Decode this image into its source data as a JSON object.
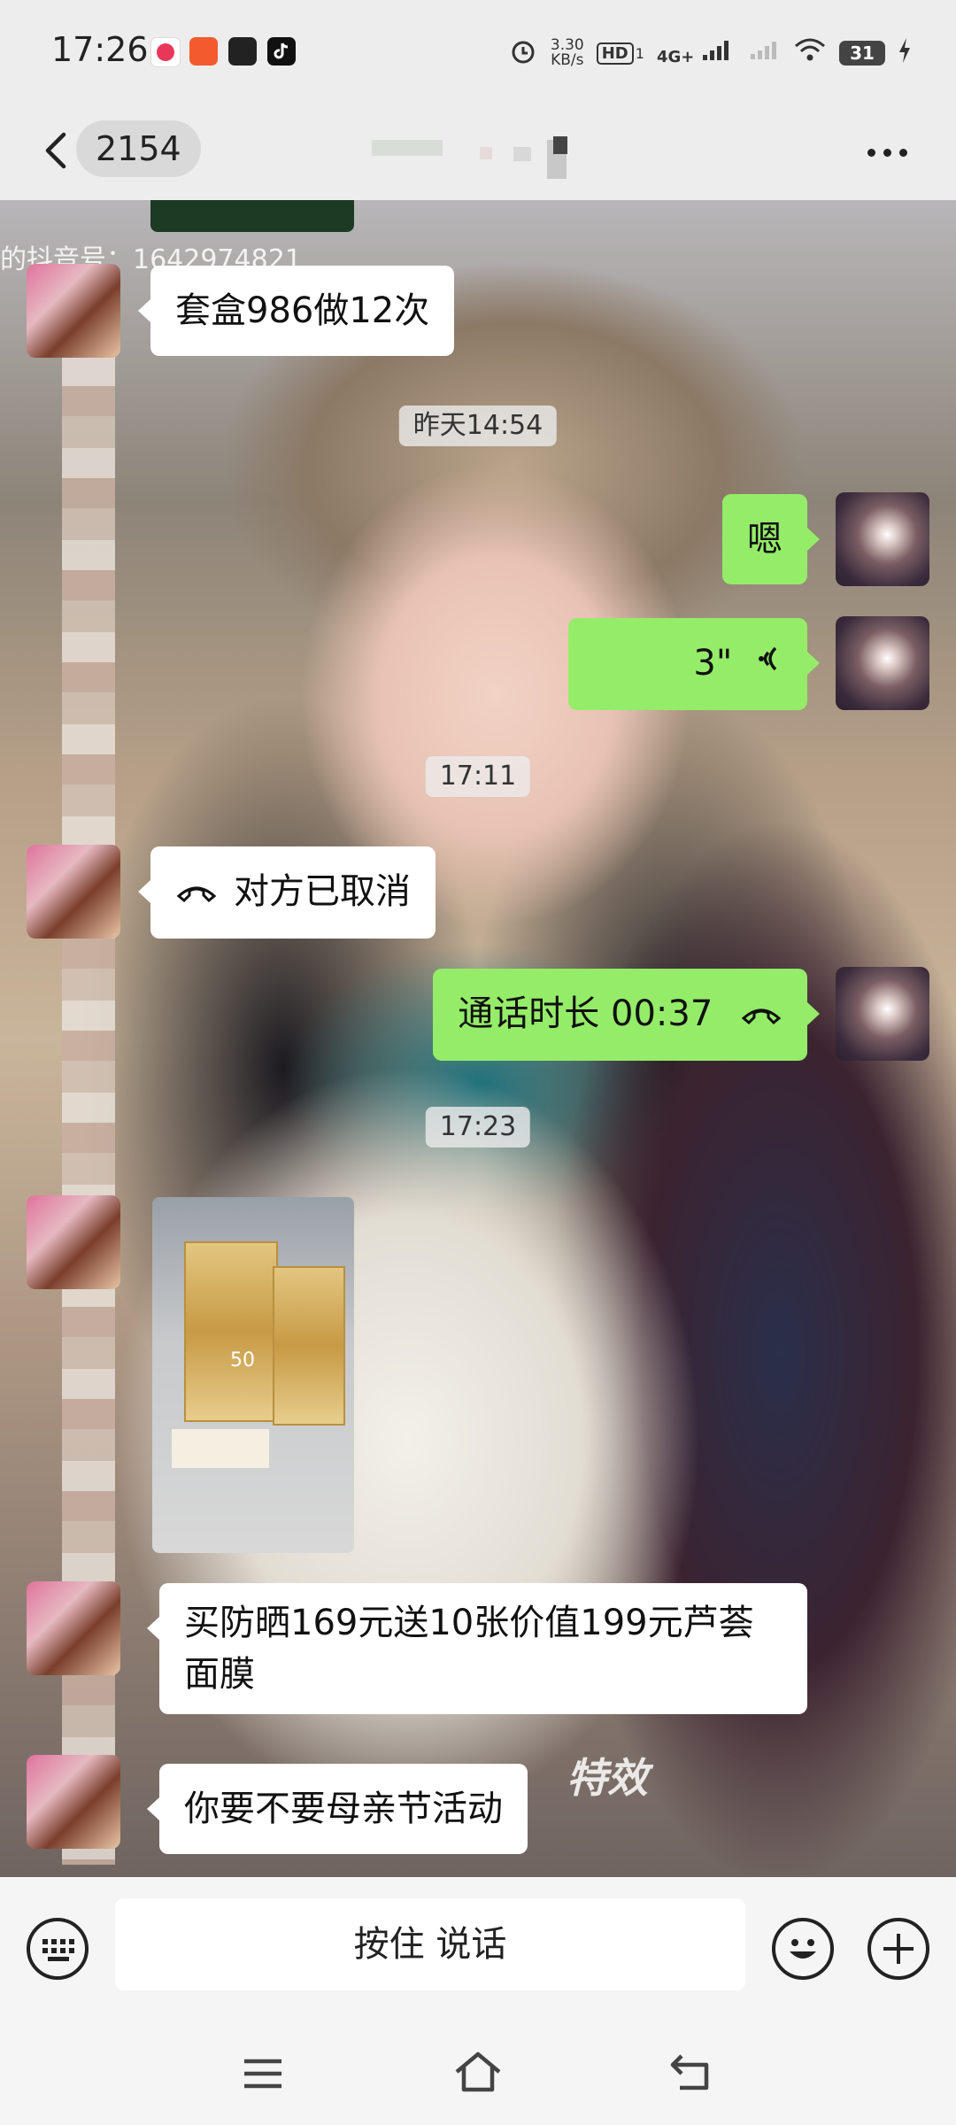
{
  "status_bar": {
    "time": "17:26",
    "net_speed_value": "3.30",
    "net_speed_unit": "KB/s",
    "hd_label": "HD",
    "hd_sub": "1",
    "network": "4G+",
    "battery": "31"
  },
  "header": {
    "back_count": "2154"
  },
  "chat": {
    "overlay_text": "的抖音号：1642974821",
    "messages": {
      "m1": "套盒986做12次",
      "t1": "昨天14:54",
      "m2": "嗯",
      "m3_duration": "3\"",
      "t2": "17:11",
      "m4": "对方已取消",
      "m5": "通话时长 00:37",
      "t3": "17:23",
      "m7": "买防晒169元送10张价值199元芦荟面膜",
      "m8": "你要不要母亲节活动"
    },
    "photo_product_mark": "50",
    "wallpaper_effect": "特效"
  },
  "input_bar": {
    "voice_label": "按住 说话"
  },
  "colors": {
    "self_bubble": "#95ec69",
    "other_bubble": "#ffffff",
    "background": "#ededed"
  },
  "icons": [
    "back-arrow-icon",
    "more-icon",
    "keyboard-icon",
    "emoji-icon",
    "plus-icon",
    "voice-wave-icon",
    "hangup-icon",
    "menu-icon",
    "home-icon",
    "back-nav-icon"
  ]
}
